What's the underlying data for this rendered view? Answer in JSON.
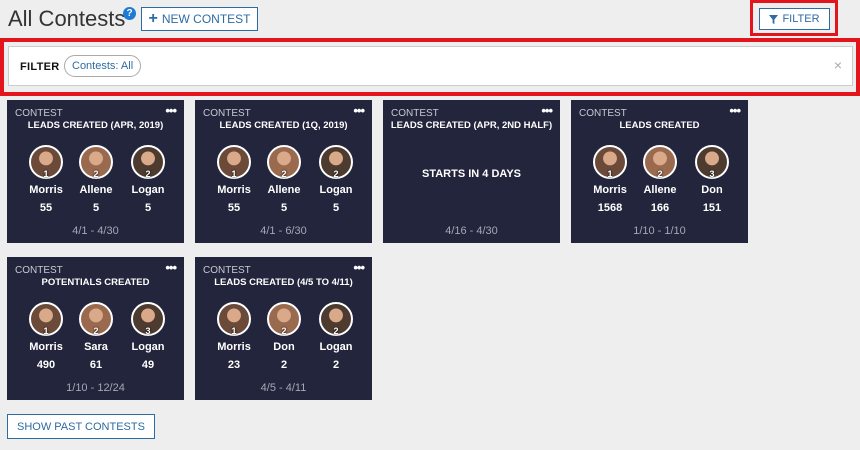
{
  "header": {
    "title": "All Contests",
    "help": "?",
    "new_contest": "NEW CONTEST",
    "filter_button": "FILTER"
  },
  "filter_bar": {
    "label": "FILTER",
    "chip": "Contests: All",
    "clear": "×"
  },
  "cards": [
    {
      "label": "CONTEST",
      "menu": "•••",
      "name": "LEADS CREATED (APR, 2019)",
      "dates": "4/1 - 4/30",
      "players": [
        {
          "rank": "1",
          "name": "Morris",
          "score": "55"
        },
        {
          "rank": "2",
          "name": "Allene",
          "score": "5"
        },
        {
          "rank": "2",
          "name": "Logan",
          "score": "5"
        }
      ]
    },
    {
      "label": "CONTEST",
      "menu": "•••",
      "name": "LEADS CREATED (1Q, 2019)",
      "dates": "4/1 - 6/30",
      "players": [
        {
          "rank": "1",
          "name": "Morris",
          "score": "55"
        },
        {
          "rank": "2",
          "name": "Allene",
          "score": "5"
        },
        {
          "rank": "2",
          "name": "Logan",
          "score": "5"
        }
      ]
    },
    {
      "label": "CONTEST",
      "menu": "•••",
      "name": "LEADS CREATED (APR, 2ND HALF)",
      "dates": "4/16 - 4/30",
      "starts": "STARTS IN 4 DAYS"
    },
    {
      "label": "CONTEST",
      "menu": "•••",
      "name": "LEADS CREATED",
      "dates": "1/10 - 1/10",
      "players": [
        {
          "rank": "1",
          "name": "Morris",
          "score": "1568"
        },
        {
          "rank": "2",
          "name": "Allene",
          "score": "166"
        },
        {
          "rank": "3",
          "name": "Don",
          "score": "151"
        }
      ]
    },
    {
      "label": "CONTEST",
      "menu": "•••",
      "name": "POTENTIALS CREATED",
      "dates": "1/10 - 12/24",
      "players": [
        {
          "rank": "1",
          "name": "Morris",
          "score": "490"
        },
        {
          "rank": "2",
          "name": "Sara",
          "score": "61"
        },
        {
          "rank": "3",
          "name": "Logan",
          "score": "49"
        }
      ]
    },
    {
      "label": "CONTEST",
      "menu": "•••",
      "name": "LEADS CREATED (4/5 TO 4/11)",
      "dates": "4/5 - 4/11",
      "players": [
        {
          "rank": "1",
          "name": "Morris",
          "score": "23"
        },
        {
          "rank": "2",
          "name": "Don",
          "score": "2"
        },
        {
          "rank": "2",
          "name": "Logan",
          "score": "2"
        }
      ]
    }
  ],
  "show_past": "SHOW PAST CONTESTS",
  "colors": {
    "highlight": "#e1151b",
    "card_bg": "#22253b",
    "accent": "#2e6ba3"
  }
}
